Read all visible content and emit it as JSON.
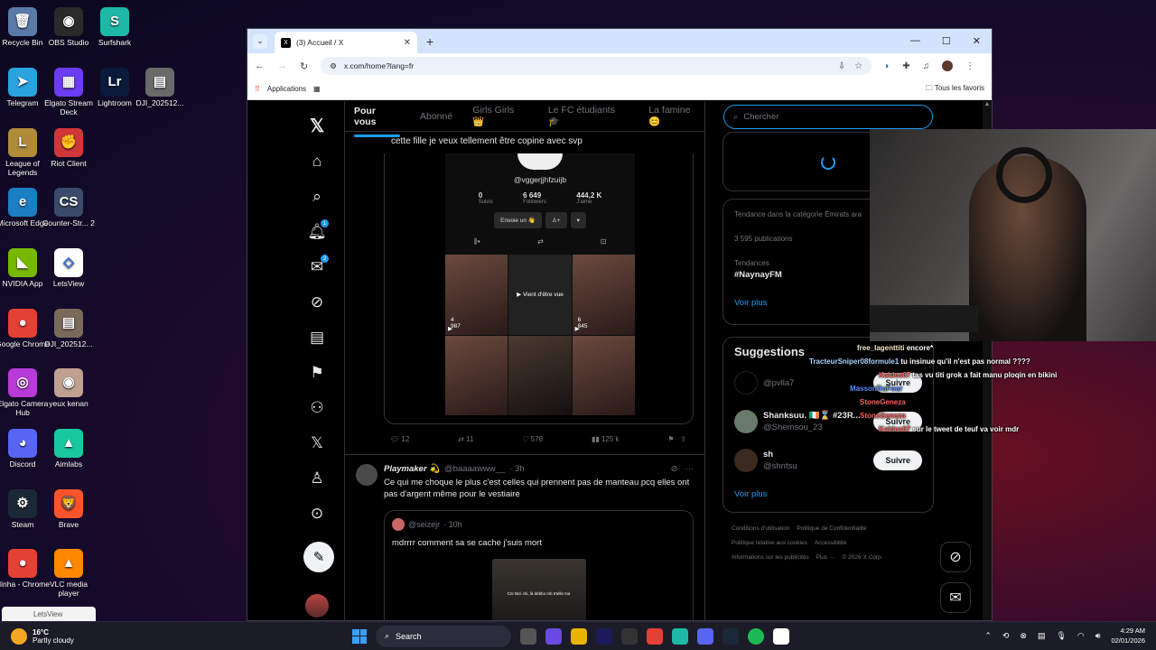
{
  "desktop": {
    "icons": [
      {
        "label": "Recycle Bin",
        "color": "#5a7aa8",
        "glyph": "🗑"
      },
      {
        "label": "OBS Studio",
        "color": "#2a2a2a",
        "glyph": "◉"
      },
      {
        "label": "Surfshark",
        "color": "#1eb9a6",
        "glyph": "S"
      },
      {
        "label": "Telegram",
        "color": "#2aa3df",
        "glyph": "➤"
      },
      {
        "label": "Elgato Stream Deck",
        "color": "#6a3df0",
        "glyph": "▦"
      },
      {
        "label": "Lightroom",
        "color": "#0a1a3a",
        "glyph": "Lr"
      },
      {
        "label": "DJI_202512...",
        "color": "#6a6a6a",
        "glyph": "▤"
      },
      {
        "label": "League of Legends",
        "color": "#b08b3a",
        "glyph": "L"
      },
      {
        "label": "Riot Client",
        "color": "#d13639",
        "glyph": "✊"
      },
      {
        "label": "Microsoft Edge",
        "color": "#1b7fc4",
        "glyph": "e"
      },
      {
        "label": "Counter-Str... 2",
        "color": "#3a4a6a",
        "glyph": "CS"
      },
      {
        "label": "NVIDIA App",
        "color": "#76b900",
        "glyph": "◣"
      },
      {
        "label": "LetsView",
        "color": "#ffffff",
        "glyph": "◇"
      },
      {
        "label": "Google Chrome",
        "color": "#e34133",
        "glyph": "●"
      },
      {
        "label": "DJI_202512...",
        "color": "#7a6a5a",
        "glyph": "▤"
      },
      {
        "label": "Elgato Camera Hub",
        "color": "#b83ad8",
        "glyph": "◎"
      },
      {
        "label": "yeux kenan",
        "color": "#c0a090",
        "glyph": "◉"
      },
      {
        "label": "Discord",
        "color": "#5865f2",
        "glyph": "◕"
      },
      {
        "label": "Aimlabs",
        "color": "#1ac8a0",
        "glyph": "▲"
      },
      {
        "label": "Steam",
        "color": "#1b2838",
        "glyph": "⚙"
      },
      {
        "label": "Brave",
        "color": "#fb542b",
        "glyph": "🦁"
      },
      {
        "label": "Ninha - Chrome",
        "color": "#e34133",
        "glyph": "●"
      },
      {
        "label": "VLC media player",
        "color": "#ff8800",
        "glyph": "▲"
      }
    ],
    "toast": "LetsView"
  },
  "browser": {
    "tab_title": "(3) Accueil / X",
    "url": "x.com/home?lang=fr",
    "bookmark_apps": "Applications",
    "bookmark_all": "Tous les favoris"
  },
  "x": {
    "badges": {
      "notifications": "1",
      "messages": "2"
    },
    "tabs": [
      "Pour vous",
      "Abonné",
      "Girls Girls 👑",
      "Le FC étudiants 🎓",
      "La famine 😊"
    ],
    "post1": {
      "text": "cette fille je veux tellement être copine avec svp",
      "tiktok": {
        "handle": "@vggerjjhfzuijb",
        "following": "0",
        "following_label": "Suivis",
        "followers": "6 649",
        "followers_label": "Followers",
        "likes": "444,2 K",
        "likes_label": "J'aime",
        "send_btn": "Envoie un 👋",
        "views": [
          "4 987",
          "▶ Vient d'être vue",
          "6 845"
        ]
      },
      "replies": "12",
      "reposts": "11",
      "likes": "578",
      "views": "125 k"
    },
    "post2": {
      "name": "Playmaker 💫",
      "handle": "@baaaawww__",
      "time": "· 3h",
      "text": "Ce qui me choque le plus c'est celles qui prennent pas de manteau pcq elles ont pas d'argent même pour le vestiaire",
      "quote_handle": "@seizejr",
      "quote_time": "· 10h",
      "quote_text": "mdrrrr comment sa se cache j'suis mort",
      "quote_img_caption": "Cnr Bici chi, là debbo mb trtelle ma"
    },
    "search_placeholder": "Chercher",
    "trends": {
      "category": "Tendance dans la catégorie Émirats ara",
      "count": "3 595 publications",
      "label": "Tendances",
      "name": "#NaynayFM",
      "see_more": "Voir plus"
    },
    "suggestions": {
      "title": "Suggestions",
      "items": [
        {
          "name": "",
          "handle": "@pvlla7",
          "button": "Suivre"
        },
        {
          "name": "Shanksuu. 🇮🇪⌛ #23R...",
          "handle": "@Shemsou_23",
          "button": "Suivre"
        },
        {
          "name": "sh",
          "handle": "@shntsu",
          "button": "Suivre"
        }
      ],
      "see_more": "Voir plus"
    },
    "footer": [
      "Conditions d'utilisation",
      "Politique de Confidentialité",
      "Politique relative aux cookies",
      "Accessibilité",
      "Informations sur les publicités",
      "Plus ···",
      "© 2026 X Corp."
    ]
  },
  "chat": [
    {
      "user": "free_lagenttiti",
      "msg": "encore*"
    },
    {
      "user": "TracteurSniper08formule1",
      "msg": "tu insinue qu'il n'est pas normal ????"
    },
    {
      "user": "Kaldes67",
      "msg": "tas vu titi grok a fait manu ploqin en bikini"
    },
    {
      "user": "MassonDuFour",
      "msg": ""
    },
    {
      "user": "StoneGeneza",
      "msg": ""
    },
    {
      "user": "StoneGeneza",
      "msg": ""
    },
    {
      "user": "Kaldes67",
      "msg": "sur le tweet de teuf va voir mdr"
    }
  ],
  "taskbar": {
    "temp": "16°C",
    "weather": "Partly cloudy",
    "search": "Search",
    "time": "4:29 AM",
    "date": "02/01/2026"
  }
}
